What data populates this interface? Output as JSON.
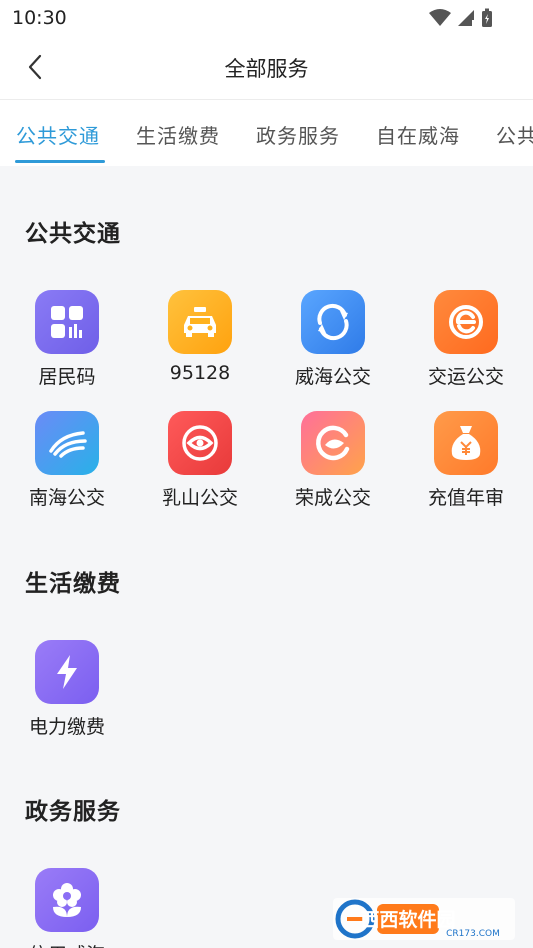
{
  "status_bar": {
    "time": "10:30"
  },
  "header": {
    "title": "全部服务"
  },
  "tabs": [
    "公共交通",
    "生活缴费",
    "政务服务",
    "自在威海",
    "公共"
  ],
  "sections": [
    {
      "title": "公共交通"
    },
    {
      "title": "生活缴费"
    },
    {
      "title": "政务服务"
    }
  ],
  "services": {
    "transport": [
      {
        "label": "居民码",
        "icon": "resident-code-icon",
        "color": "#7b6cf0"
      },
      {
        "label": "95128",
        "icon": "taxi-icon",
        "color": "#ffb21e"
      },
      {
        "label": "威海公交",
        "icon": "weihai-bus-icon",
        "color": "#3d8cf2"
      },
      {
        "label": "交运公交",
        "icon": "jiaoyun-bus-icon",
        "color": "#ff7a2c"
      },
      {
        "label": "南海公交",
        "icon": "nanhai-bus-icon",
        "color": "#3fa0f0"
      },
      {
        "label": "乳山公交",
        "icon": "rushan-bus-icon",
        "color": "#f24b4b"
      },
      {
        "label": "荣成公交",
        "icon": "rongcheng-bus-icon",
        "color": "#ff6f6a"
      },
      {
        "label": "充值年审",
        "icon": "money-bag-icon",
        "color": "#ff8a3a"
      }
    ],
    "life": [
      {
        "label": "电力缴费",
        "icon": "lightning-icon",
        "color": "#8b6ef5"
      }
    ],
    "gov": [
      {
        "label": "信用威海",
        "icon": "flower-icon",
        "color": "#8b6ef5"
      }
    ]
  },
  "watermark": {
    "text": "西西软件园",
    "sub": "CR173.COM"
  }
}
